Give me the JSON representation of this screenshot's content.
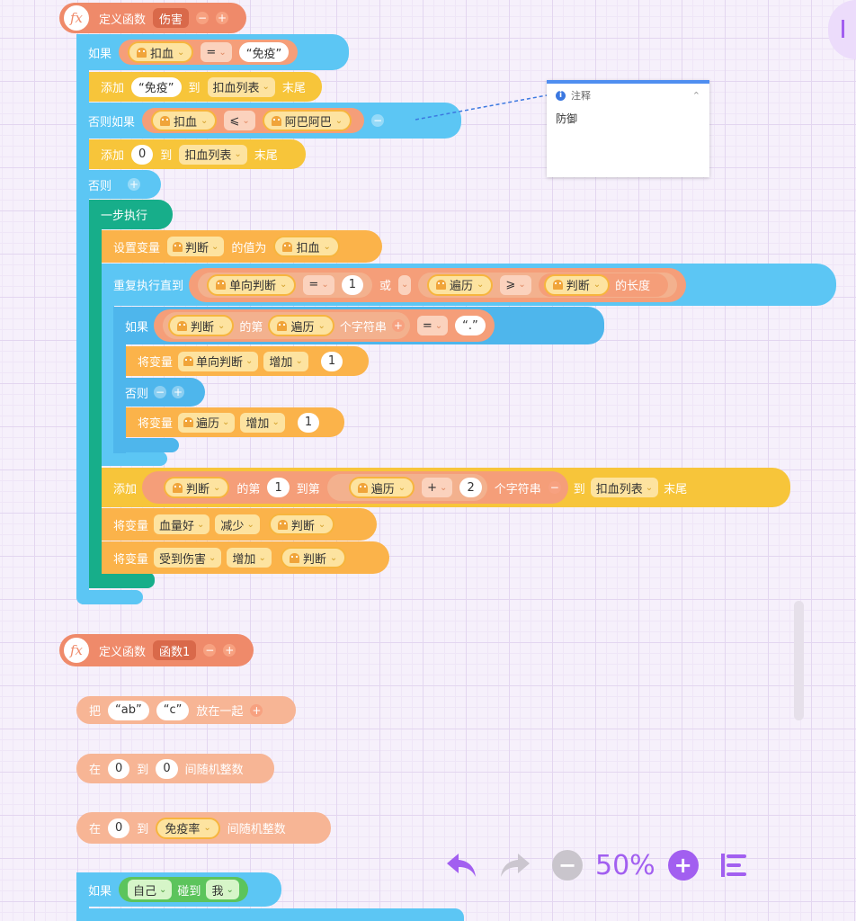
{
  "func_damage": {
    "define_label": "定义函数",
    "name": "伤害",
    "if_label": "如果",
    "if_var": "扣血",
    "if_op": "=",
    "if_value": "“免疫”",
    "add1_label": "添加",
    "add1_value": "“免疫”",
    "to_label": "到",
    "list_name": "扣血列表",
    "end_label": "末尾",
    "elseif_label": "否则如果",
    "elseif_var": "扣血",
    "elseif_op": "⩽",
    "elseif_var2": "阿巴阿巴",
    "add2_value": "0",
    "else_label": "否则",
    "step_label": "一步执行",
    "set_label": "设置变量",
    "set_var": "判断",
    "set_mid": "的值为",
    "set_value_var": "扣血",
    "repeat_label": "重复执行直到",
    "rep_var1": "单向判断",
    "rep_op1": "=",
    "rep_val1": "1",
    "rep_or": "或",
    "rep_var2": "遍历",
    "rep_op2": "⩾",
    "rep_var3": "判断",
    "rep_len": "的长度",
    "inner_if": "如果",
    "inner_var1": "判断",
    "inner_of": "的第",
    "inner_var2": "遍历",
    "inner_char": "个字符串",
    "inner_op": "=",
    "inner_val": "“.”",
    "change_label": "将变量",
    "change_var1": "单向判断",
    "change_op": "增加",
    "change_val": "1",
    "inner_else": "否则",
    "change_var2": "遍历",
    "add3_label": "添加",
    "add3_var": "判断",
    "add3_of": "的第",
    "add3_n": "1",
    "add3_to": "到第",
    "add3_var2": "遍历",
    "add3_plus": "+",
    "add3_n2": "2",
    "add3_char": "个字符串",
    "add3_list_to": "到",
    "add3_list": "扣血列表",
    "add3_end": "末尾",
    "dec_label": "将变量",
    "dec_var": "血量好",
    "dec_op": "减少",
    "dec_val": "判断",
    "inc_label": "将变量",
    "inc_var": "受到伤害",
    "inc_op": "增加",
    "inc_val": "判断"
  },
  "comment": {
    "title": "注释",
    "body": "防御"
  },
  "func1": {
    "define_label": "定义函数",
    "name": "函数1"
  },
  "join_block": {
    "label": "把",
    "a": "“ab”",
    "b": "“c”",
    "suffix": "放在一起"
  },
  "rand1": {
    "label": "在",
    "from": "0",
    "to_label": "到",
    "to": "0",
    "suffix": "间随机整数"
  },
  "rand2": {
    "label": "在",
    "from": "0",
    "to_label": "到",
    "to_var": "免疫率",
    "suffix": "间随机整数"
  },
  "touch_if": {
    "label": "如果",
    "a": "自己",
    "mid": "碰到",
    "b": "我"
  },
  "toolbar": {
    "zoom": "50%",
    "undo": "undo",
    "redo": "redo",
    "zoom_out": "−",
    "zoom_in": "+"
  },
  "colors": {
    "function": "#ef8a6a",
    "control": "#5cc6f4",
    "list": "#f7c53a",
    "variable": "#fbb34a",
    "step": "#17ae8a",
    "operator": "#f59e79",
    "accent": "#a25ff0"
  }
}
